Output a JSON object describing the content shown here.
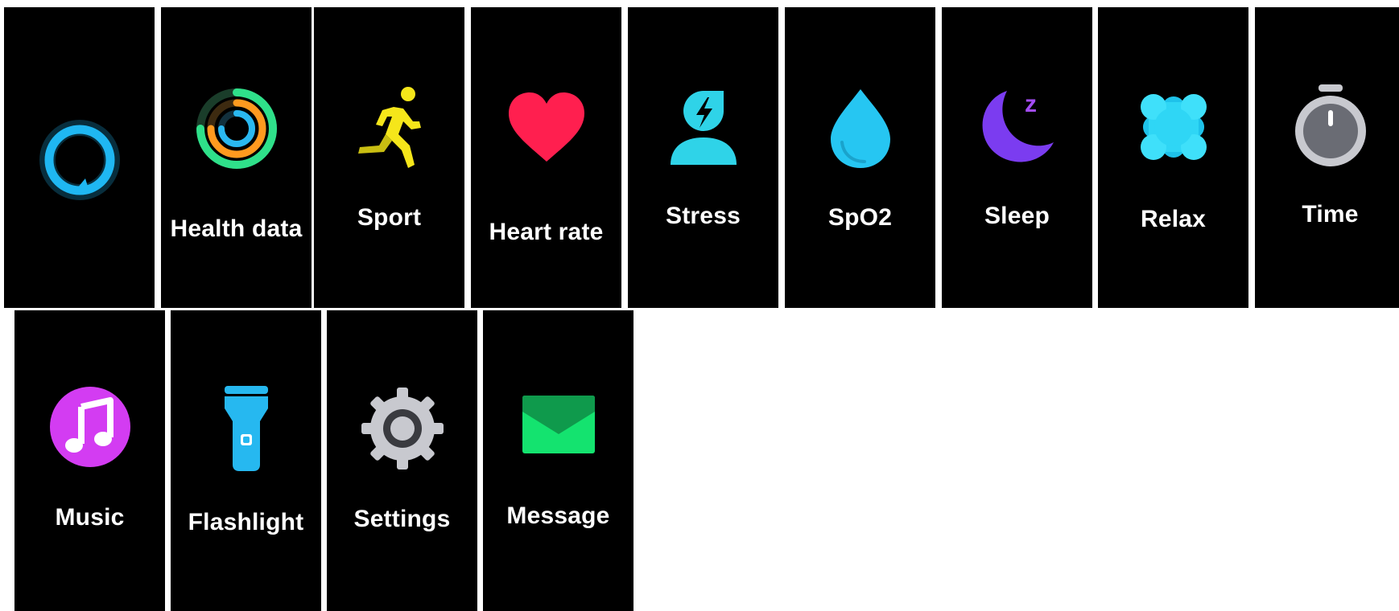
{
  "apps": {
    "row1": [
      {
        "label": "",
        "icon": "alexa-ring-icon"
      },
      {
        "label": "Health data",
        "icon": "activity-rings-icon"
      },
      {
        "label": "Sport",
        "icon": "running-person-icon"
      },
      {
        "label": "Heart rate",
        "icon": "heart-icon"
      },
      {
        "label": "Stress",
        "icon": "stress-person-icon"
      },
      {
        "label": "SpO2",
        "icon": "water-drop-icon"
      },
      {
        "label": "Sleep",
        "icon": "moon-icon"
      },
      {
        "label": "Relax",
        "icon": "lotus-flower-icon"
      },
      {
        "label": "Time",
        "icon": "stopwatch-icon"
      }
    ],
    "row2": [
      {
        "label": "Music",
        "icon": "music-note-icon"
      },
      {
        "label": "Flashlight",
        "icon": "flashlight-icon"
      },
      {
        "label": "Settings",
        "icon": "gear-icon"
      },
      {
        "label": "Message",
        "icon": "envelope-icon"
      }
    ]
  },
  "colors": {
    "tile_background": "#000000",
    "page_background": "#ffffff",
    "label": "#ffffff",
    "alexa": "#1fb7f2",
    "health_outer": "#2fe08a",
    "health_middle": "#ff9a1f",
    "health_inner": "#2ab8f0",
    "sport": "#f5e61a",
    "heart": "#ff1f4f",
    "stress": "#2fd3e8",
    "spo2": "#26c6f2",
    "sleep": "#7b3cf0",
    "relax": "#2fd6f5",
    "time": "#a6a8b0",
    "music": "#d33cf2",
    "flashlight": "#26b8f0",
    "settings": "#c8c9cf",
    "message": "#14e36f"
  }
}
